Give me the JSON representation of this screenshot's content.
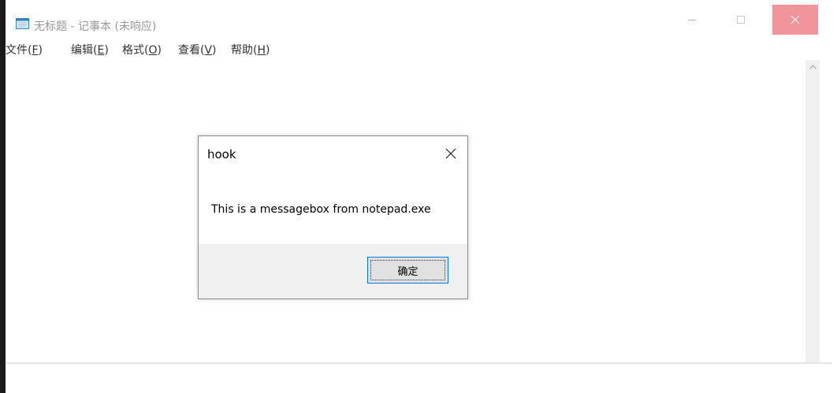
{
  "window": {
    "title": "无标题 - 记事本 (未响应)",
    "colors": {
      "close_button_bg": "#f1959b",
      "title_text": "#999999"
    },
    "controls": {
      "minimize_icon": "minimize-icon",
      "maximize_icon": "maximize-icon",
      "close_icon": "close-icon"
    }
  },
  "menubar": {
    "items": [
      {
        "label": "文件(",
        "key": "F",
        "tail": ")"
      },
      {
        "label": "编辑(",
        "key": "E",
        "tail": ")"
      },
      {
        "label": "格式(",
        "key": "O",
        "tail": ")"
      },
      {
        "label": "查看(",
        "key": "V",
        "tail": ")"
      },
      {
        "label": "帮助(",
        "key": "H",
        "tail": ")"
      }
    ]
  },
  "dialog": {
    "title": "hook",
    "message": "This is a messagebox from notepad.exe",
    "ok_label": "确定",
    "colors": {
      "accent": "#0078d7",
      "footer_bg": "#f0f0f0"
    }
  }
}
